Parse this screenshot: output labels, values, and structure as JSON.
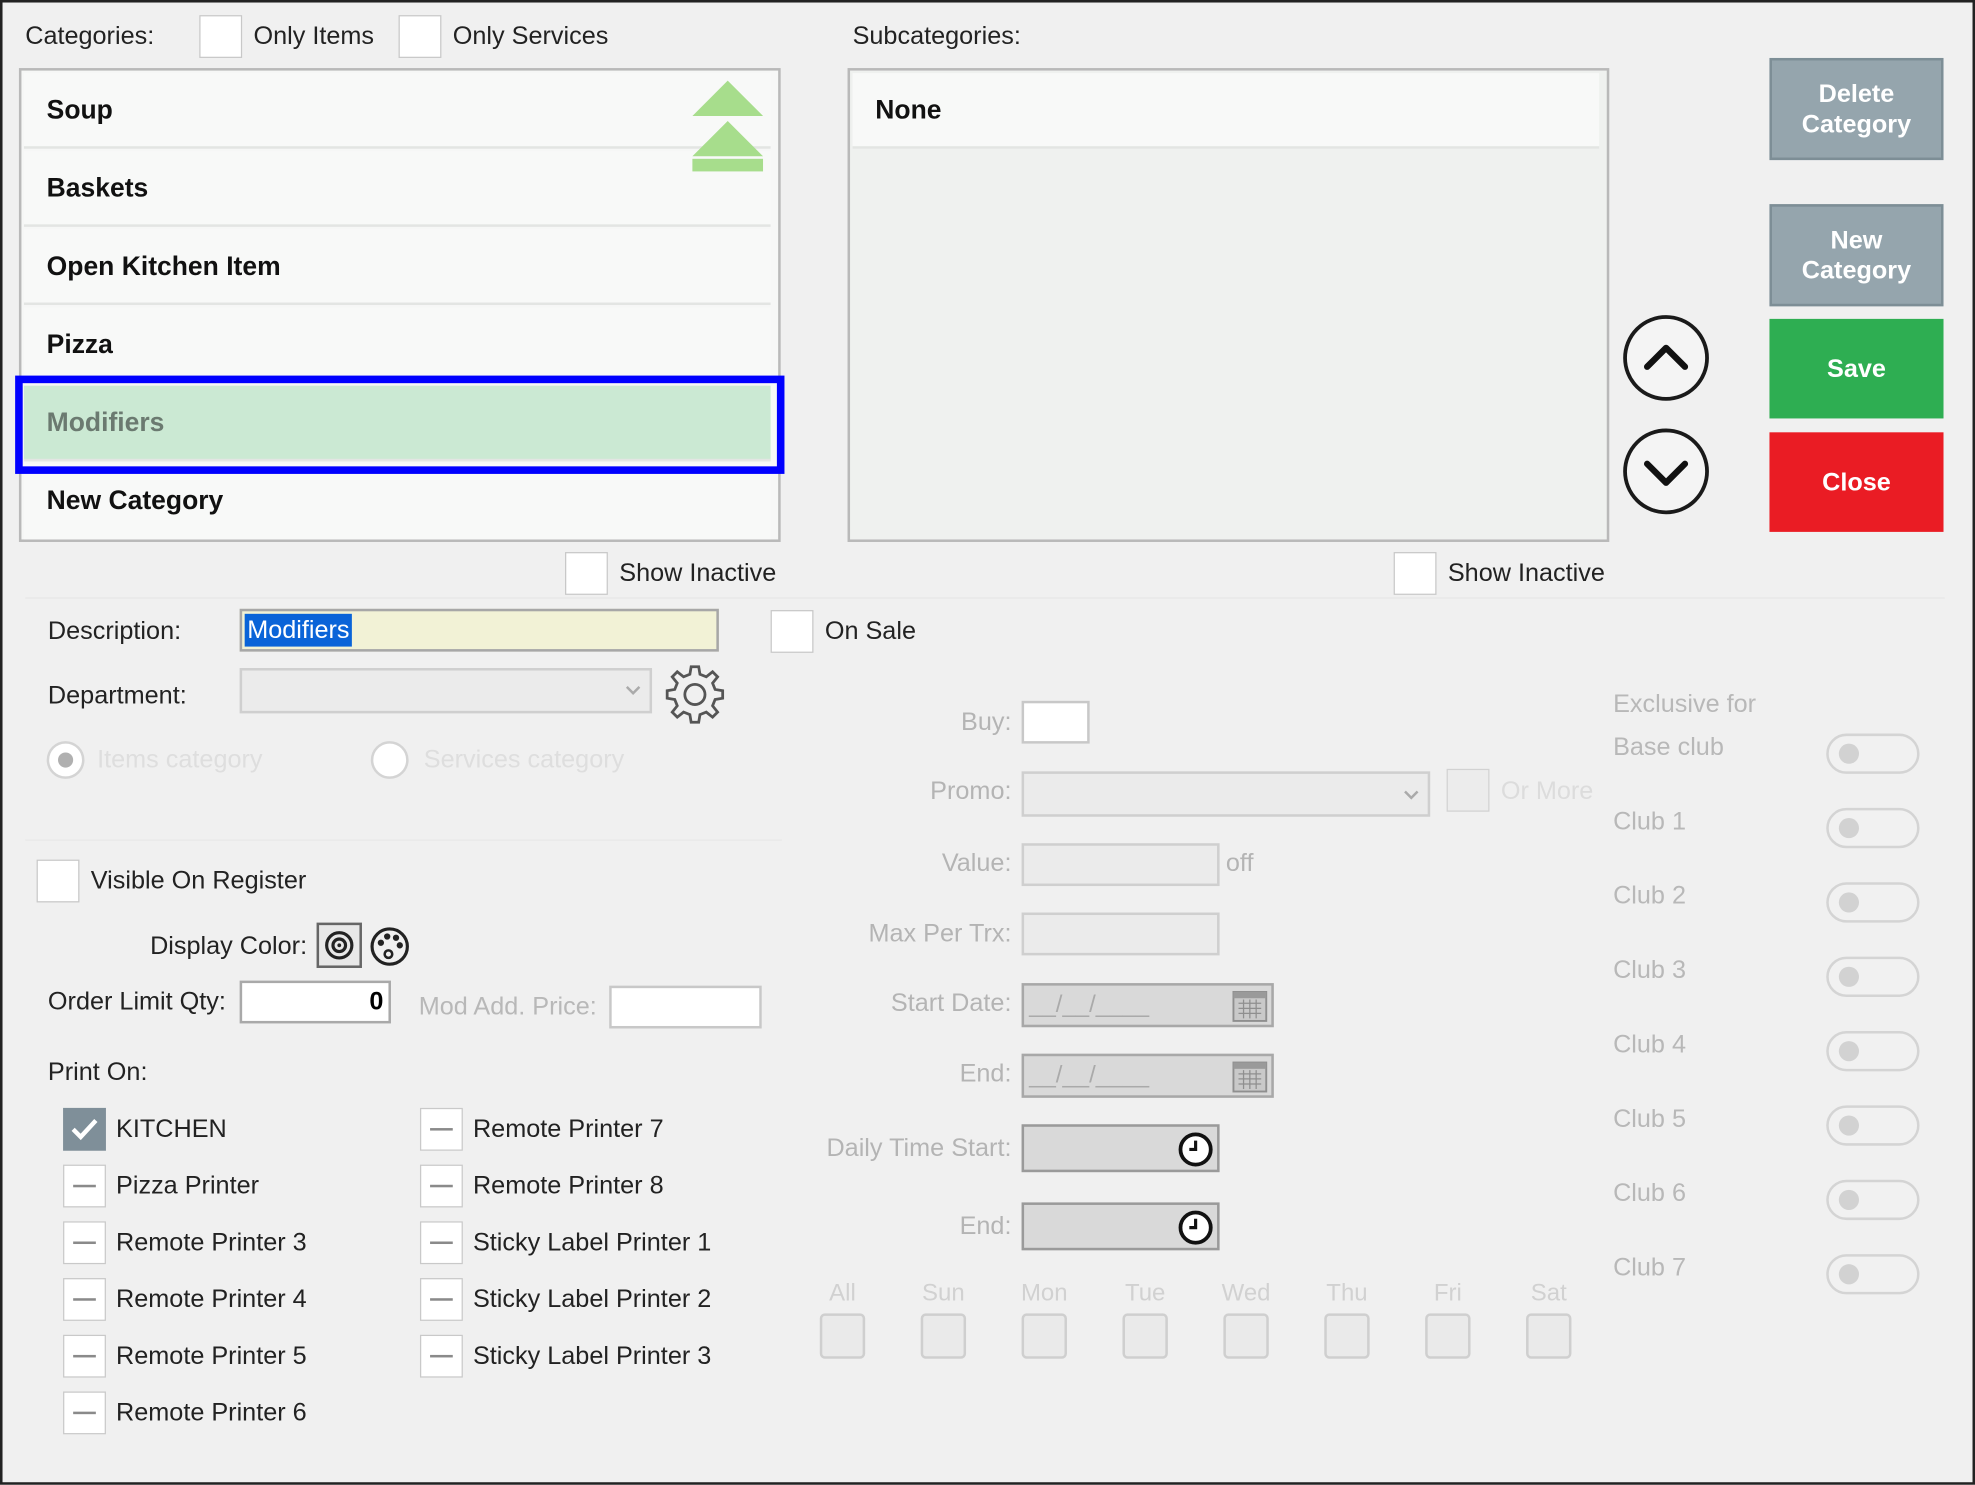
{
  "categories_panel": {
    "label": "Categories:",
    "only_items": "Only Items",
    "only_services": "Only Services",
    "items": [
      "Soup",
      "Baskets",
      "Open Kitchen Item",
      "Pizza",
      "Modifiers",
      "New Category"
    ],
    "selected": "Modifiers",
    "show_inactive": "Show Inactive"
  },
  "subcategories_panel": {
    "label": "Subcategories:",
    "items": [
      "None"
    ],
    "show_inactive": "Show Inactive"
  },
  "buttons": {
    "delete_category": "Delete Category",
    "new_category": "New Category",
    "save": "Save",
    "close": "Close"
  },
  "colors": {
    "selected_row": "#cbe9d3",
    "selection_border": "#0000ff",
    "save": "#2eae52",
    "close": "#ea1c24",
    "gray_button": "#95a5ad",
    "scroll_arrow": "#a7dd8c"
  },
  "form": {
    "description_label": "Description:",
    "description_value": "Modifiers",
    "on_sale": "On Sale",
    "department_label": "Department:",
    "items_category": "Items category",
    "services_category": "Services category",
    "visible_on_register": "Visible On Register",
    "display_color_label": "Display Color:",
    "order_limit_label": "Order Limit Qty:",
    "order_limit_value": "0",
    "mod_add_price_label": "Mod Add. Price:",
    "print_on_label": "Print On:"
  },
  "printers_left": [
    {
      "name": "KITCHEN",
      "checked": true
    },
    {
      "name": "Pizza Printer",
      "checked": false
    },
    {
      "name": "Remote Printer 3",
      "checked": false
    },
    {
      "name": "Remote Printer 4",
      "checked": false
    },
    {
      "name": "Remote Printer 5",
      "checked": false
    },
    {
      "name": "Remote Printer 6",
      "checked": false
    }
  ],
  "printers_right": [
    {
      "name": "Remote Printer 7",
      "checked": false
    },
    {
      "name": "Remote Printer 8",
      "checked": false
    },
    {
      "name": "Sticky Label Printer 1",
      "checked": false
    },
    {
      "name": "Sticky Label Printer 2",
      "checked": false
    },
    {
      "name": "Sticky Label Printer 3",
      "checked": false
    }
  ],
  "promo": {
    "buy_label": "Buy:",
    "promo_label": "Promo:",
    "or_more": "Or More",
    "value_label": "Value:",
    "off": "off",
    "max_per_trx_label": "Max Per Trx:",
    "start_date_label": "Start Date:",
    "date_placeholder": "__/__/____",
    "end_label": "End:",
    "daily_time_start_label": "Daily Time Start:",
    "days": [
      "All",
      "Sun",
      "Mon",
      "Tue",
      "Wed",
      "Thu",
      "Fri",
      "Sat"
    ]
  },
  "clubs": {
    "exclusive_for": "Exclusive for",
    "items": [
      "Base club",
      "Club 1",
      "Club 2",
      "Club 3",
      "Club 4",
      "Club 5",
      "Club 6",
      "Club 7"
    ]
  }
}
